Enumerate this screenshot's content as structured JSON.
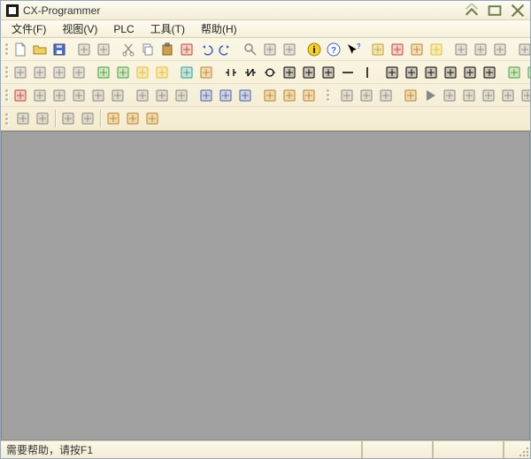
{
  "title": "CX-Programmer",
  "menu": [
    "文件(F)",
    "视图(V)",
    "PLC",
    "工具(T)",
    "帮助(H)"
  ],
  "status": {
    "help": "需要帮助，请按F1"
  },
  "toolbar_rows": [
    {
      "groups": [
        [
          "new-file",
          "open-file",
          "save-file"
        ],
        [
          "print",
          "print-preview"
        ],
        [
          "cut",
          "copy",
          "paste",
          "delete",
          "undo",
          "redo"
        ],
        [
          "find",
          "replace",
          "goto"
        ],
        [
          "info-yellow",
          "help-context",
          "whats-this"
        ],
        [
          "bell",
          "user1",
          "user2",
          "user3"
        ],
        [
          "flag1",
          "flag2",
          "pause-flag"
        ],
        [
          "block1",
          "block2",
          "block3"
        ]
      ]
    },
    {
      "groups": [
        [
          "cursor",
          "zoom-out",
          "zoom-in",
          "zoom-fit"
        ],
        [
          "db-green",
          "db-list",
          "db-yellow",
          "grid-yellow"
        ],
        [
          "grid-teal",
          "hourglass"
        ],
        [
          "contact-no",
          "contact-nc",
          "coil",
          "coil-set",
          "coil-reset",
          "coil-diff",
          "line-h",
          "line-v"
        ],
        [
          "rung-above",
          "rung-below",
          "branch",
          "branch-down",
          "delete-rung",
          "merge"
        ],
        [
          "compile",
          "build"
        ],
        [
          "xfer-to",
          "xfer-from",
          "verify",
          "online-edit"
        ]
      ]
    },
    {
      "groups": [
        [
          "link1",
          "link2",
          "link3",
          "link4",
          "link5",
          "link6"
        ],
        [
          "win1",
          "win2",
          "win3"
        ],
        [
          "num10",
          "num10b",
          "num16"
        ],
        [
          "stack1",
          "stack2",
          "stack3"
        ],
        [],
        [
          "layer1",
          "layer2",
          "layer3"
        ],
        [
          "watch",
          "play",
          "step-in",
          "step-over",
          "step-out",
          "go-start",
          "go-end",
          "step-back",
          "step-fwd",
          "go-last"
        ]
      ]
    },
    {
      "groups": [
        [
          "indent-left",
          "indent-right"
        ],
        [
          "align1",
          "align2"
        ],
        [
          "spark1",
          "spark2",
          "spark3"
        ]
      ]
    }
  ],
  "icon_colors": {
    "new-file": "#fff",
    "open-file": "#e8c040",
    "save-file": "#4060c0",
    "print": "#888",
    "print-preview": "#888",
    "cut": "#888",
    "copy": "#888",
    "paste": "#c08040",
    "delete": "#c04040",
    "undo": "#4060c0",
    "redo": "#4060c0",
    "find": "#888",
    "replace": "#888",
    "goto": "#888",
    "info-yellow": "#e0c020",
    "help-context": "#4060c0",
    "whats-this": "#4060c0",
    "bell": "#c0a020",
    "user1": "#c04040",
    "user2": "#c08020",
    "user3": "#e0c020",
    "flag1": "#888",
    "flag2": "#888",
    "pause-flag": "#888",
    "block1": "#888",
    "block2": "#888",
    "block3": "#888",
    "cursor": "#888",
    "zoom-out": "#888",
    "zoom-in": "#888",
    "zoom-fit": "#888",
    "db-green": "#40a040",
    "db-list": "#40a040",
    "db-yellow": "#e0c020",
    "grid-yellow": "#e0c020",
    "grid-teal": "#20a0a0",
    "hourglass": "#c08020",
    "contact-no": "#000",
    "contact-nc": "#000",
    "coil": "#000",
    "coil-set": "#000",
    "coil-reset": "#000",
    "coil-diff": "#000",
    "line-h": "#000",
    "line-v": "#000",
    "rung-above": "#000",
    "rung-below": "#000",
    "branch": "#000",
    "branch-down": "#000",
    "delete-rung": "#000",
    "merge": "#000",
    "compile": "#40a040",
    "build": "#40a040",
    "xfer-to": "#888",
    "xfer-from": "#888",
    "verify": "#888",
    "online-edit": "#888",
    "link1": "#c04040",
    "link2": "#888",
    "link3": "#888",
    "link4": "#888",
    "link5": "#888",
    "link6": "#888",
    "win1": "#888",
    "win2": "#888",
    "win3": "#888",
    "num10": "#4060c0",
    "num10b": "#4060c0",
    "num16": "#4060c0",
    "stack1": "#c08020",
    "stack2": "#c08020",
    "stack3": "#c08020",
    "layer1": "#888",
    "layer2": "#888",
    "layer3": "#888",
    "watch": "#c08020",
    "play": "#40a040",
    "step-in": "#888",
    "step-over": "#888",
    "step-out": "#888",
    "go-start": "#888",
    "go-end": "#888",
    "step-back": "#888",
    "step-fwd": "#888",
    "go-last": "#888",
    "indent-left": "#888",
    "indent-right": "#888",
    "align1": "#888",
    "align2": "#888",
    "spark1": "#c08020",
    "spark2": "#c08020",
    "spark3": "#c08020"
  }
}
